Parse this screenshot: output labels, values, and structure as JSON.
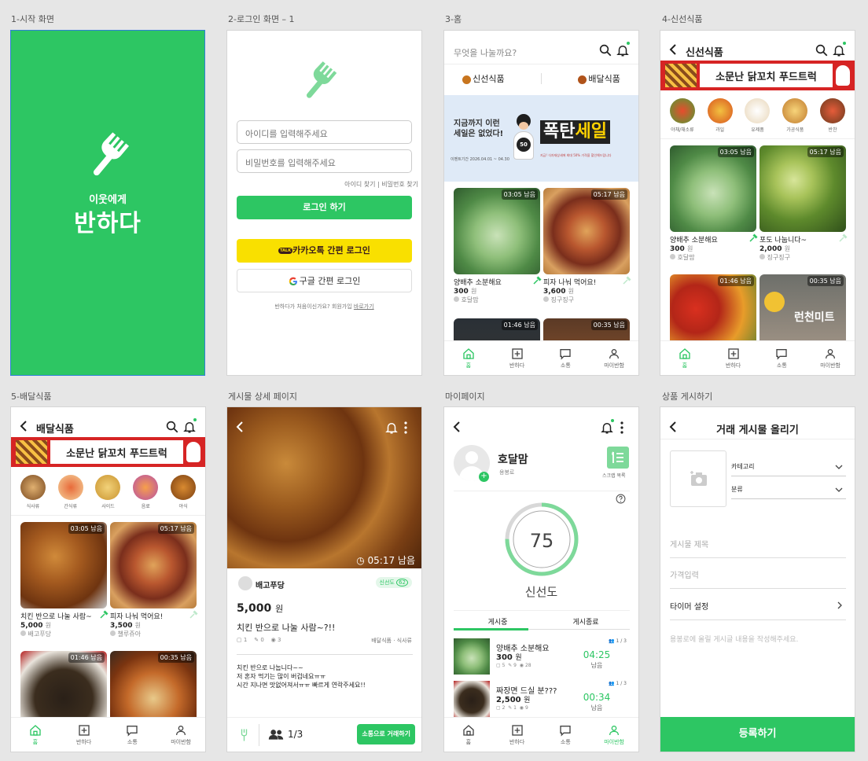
{
  "labels": {
    "f1": "1-시작 화면",
    "f2": "2-로그인 화면 – 1",
    "f3": "3-홈",
    "f4": "4-신선식품",
    "f5": "5-배달식품",
    "f6": "게시물 상세 페이지",
    "f7": "마이페이지",
    "f8": "상품 게시하기"
  },
  "colors": {
    "accent": "#2dc663",
    "kakao": "#f9e000",
    "ad_red": "#d62424"
  },
  "splash": {
    "subtitle": "이웃에게",
    "title": "반하다"
  },
  "login": {
    "id_placeholder": "아이디를 입력해주세요",
    "pw_placeholder": "비밀번호를 입력해주세요",
    "find_id": "아이디 찾기",
    "find_pw": "비밀번호 찾기",
    "login_btn": "로그인 하기",
    "kakao_btn": "카카오톡 간편 로그인",
    "kakao_badge": "TALK",
    "google_btn": "구글 간편 로그인",
    "signup_text": "반하다가 처음이신가요? 회원가입",
    "signup_link": "바로가기"
  },
  "nav": {
    "home": "홈",
    "post": "반하다",
    "chat": "소통",
    "mypage": "마이반함"
  },
  "home": {
    "search_placeholder": "무엇을 나눌까요?",
    "tab_fresh": "신선식품",
    "tab_delivery": "배달식품",
    "banner_left": "지금까지 이런 세일은 없었다!",
    "banner_date": "이벤트기간 2026.04.01 ~ 04.30",
    "banner_badge": "50",
    "banner_big_a": "폭탄",
    "banner_big_b": "세일",
    "banner_small": "지금! 식자재상세에 최대 50% 가격을 할인해드립니다",
    "cards": [
      {
        "time": "03:05 남음",
        "title": "양배추 소분해요",
        "price": "300",
        "unit": "원",
        "seller": "호달맘"
      },
      {
        "time": "05:17 남음",
        "title": "피자 나눠 먹어요!",
        "price": "3,600",
        "unit": "원",
        "seller": "징구징구"
      },
      {
        "time": "01:46 남음"
      },
      {
        "time": "00:35 남음"
      }
    ]
  },
  "fresh": {
    "title": "신선식품",
    "ad": "소문난 닭꼬치 푸드트럭",
    "ad_script": "닭꼬치",
    "categories": [
      "야채/채소류",
      "과일",
      "유제품",
      "가공식품",
      "반찬"
    ],
    "cards": [
      {
        "time": "03:05 남음",
        "title": "양배추 소분해요",
        "price": "300",
        "unit": "원",
        "seller": "호달맘"
      },
      {
        "time": "05:17 남음",
        "title": "포도 나눕니다~",
        "price": "2,000",
        "unit": "원",
        "seller": "징구징구"
      },
      {
        "time": "01:46 남음"
      },
      {
        "time": "00:35 남음",
        "label": "런천미트"
      }
    ]
  },
  "delivery": {
    "title": "배달식품",
    "ad": "소문난 닭꼬치 푸드트럭",
    "ad_script": "닭꼬치",
    "categories": [
      "식사류",
      "간식류",
      "사이드",
      "음료",
      "야식"
    ],
    "cards": [
      {
        "time": "03:05 남음",
        "title": "치킨 반으로 나눌 사람~",
        "price": "5,000",
        "unit": "원",
        "seller": "배고푸당"
      },
      {
        "time": "05:17 남음",
        "title": "피자 나눠 먹어요!",
        "price": "3,500",
        "unit": "원",
        "seller": "챌루쥬아"
      },
      {
        "time": "01:46 남음"
      },
      {
        "time": "00:35 남음"
      }
    ]
  },
  "detail": {
    "time": "05:17 남음",
    "seller": "배고푸당",
    "freshness_label": "신선도",
    "freshness_value": "62",
    "price": "5,000",
    "unit": "원",
    "title": "치킨 반으로 나눌 사람~?!!",
    "stats": [
      "1",
      "0",
      "3"
    ],
    "category": "배달식품 · 식사류",
    "body": [
      "치킨 반으로 나눕니다~~",
      "저 혼자 먹기는 많이 버겁네요ㅠㅠ",
      "시간 지나면 맛없어져서ㅠㅠ 빠르게 연락주세요!!"
    ],
    "participants": "1/3",
    "chat_btn": "소통으로 거래하기"
  },
  "mypage": {
    "name": "호달맘",
    "region": "용봉로",
    "scrap": "스크랩 목록",
    "score": "75",
    "score_max": 100,
    "score_label": "신선도",
    "tab_active": "게시중",
    "tab_done": "게시종료",
    "items": [
      {
        "title": "양배추 소분해요",
        "price": "300",
        "unit": "원",
        "stats": [
          "5",
          "9",
          "28"
        ],
        "people": "1 / 3",
        "time": "04:25",
        "remain": "남음"
      },
      {
        "title": "짜장면 드실 분???",
        "price": "2,500",
        "unit": "원",
        "stats": [
          "2",
          "1",
          "9"
        ],
        "people": "1 / 3",
        "time": "00:34",
        "remain": "남음"
      }
    ]
  },
  "post": {
    "title": "거래 게시물 올리기",
    "category": "카테고리",
    "kind": "분류",
    "title_ph": "게시물 제목",
    "price_ph": "가격입력",
    "timer": "타이머 설정",
    "body_ph": "용봉로에 올릴 게시글 내용을 작성해주세요.",
    "submit": "등록하기"
  }
}
